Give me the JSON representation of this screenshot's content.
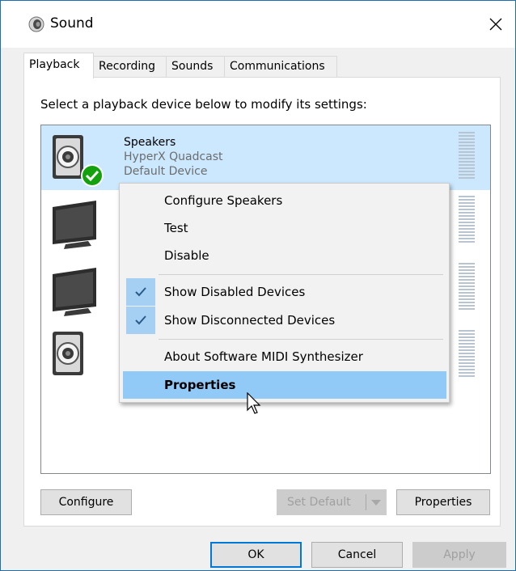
{
  "window": {
    "title": "Sound",
    "icon": "speaker-icon"
  },
  "tabs": [
    {
      "label": "Playback",
      "active": true
    },
    {
      "label": "Recording",
      "active": false
    },
    {
      "label": "Sounds",
      "active": false
    },
    {
      "label": "Communications",
      "active": false
    }
  ],
  "instruction": "Select a playback device below to modify its settings:",
  "devices": [
    {
      "name": "Speakers",
      "line2": "HyperX Quadcast",
      "line3": "Default Device",
      "icon": "speaker-icon",
      "selected": true
    },
    {
      "name": "",
      "icon": "monitor-icon"
    },
    {
      "name": "",
      "icon": "monitor-icon"
    },
    {
      "name": "",
      "icon": "speaker-icon"
    }
  ],
  "context_menu": {
    "items": [
      {
        "label": "Configure Speakers",
        "checked": false
      },
      {
        "label": "Test",
        "checked": false
      },
      {
        "label": "Disable",
        "checked": false
      },
      {
        "label": "Show Disabled Devices",
        "checked": true
      },
      {
        "label": "Show Disconnected Devices",
        "checked": true
      },
      {
        "label": "About Software MIDI Synthesizer",
        "checked": false
      },
      {
        "label": "Properties",
        "checked": false,
        "hovered": true
      }
    ]
  },
  "buttons": {
    "configure": "Configure",
    "set_default": "Set Default",
    "properties": "Properties",
    "ok": "OK",
    "cancel": "Cancel",
    "apply": "Apply"
  },
  "colors": {
    "selection": "#cce8ff",
    "menu_hover": "#91c9f7",
    "accent": "#0078d7",
    "default_check": "#13a10e"
  }
}
